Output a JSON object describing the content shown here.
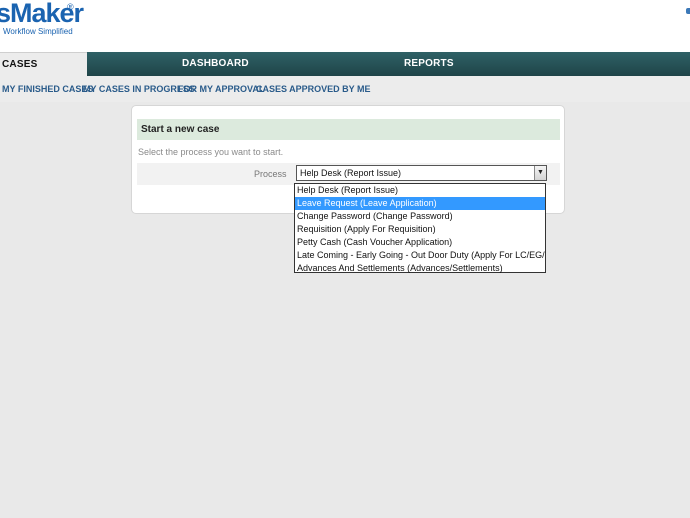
{
  "logo": {
    "text": "sMaker",
    "reg": "®",
    "tagline": "Workflow Simplified"
  },
  "mainnav": {
    "cases": "CASES",
    "dashboard": "DASHBOARD",
    "reports": "REPORTS"
  },
  "subnav": {
    "finished": "MY FINISHED CASES",
    "in_progress": "MY CASES IN PROGRESS",
    "approval": "FOR MY APPROVAL",
    "approved": "CASES APPROVED BY ME"
  },
  "panel": {
    "title": "Start a new case",
    "hint": "Select the process you want to start.",
    "process_label": "Process",
    "selected_value": "Help Desk (Report Issue)",
    "arrow": "▼"
  },
  "dropdown": {
    "highlighted_index": 1,
    "options": [
      "Help Desk (Report Issue)",
      "Leave Request (Leave Application)",
      "Change Password (Change Password)",
      "Requisition (Apply For Requisition)",
      "Petty Cash (Cash Voucher Application)",
      "Late Coming - Early Going - Out Door Duty (Apply For LC/EG/OD)",
      "Advances And Settlements (Advances/Settlements)"
    ]
  },
  "colors": {
    "brand": "#1a63b0",
    "nav_bg": "#2f6166",
    "highlight": "#3399ff",
    "panel_title_bg": "#dceadd"
  }
}
